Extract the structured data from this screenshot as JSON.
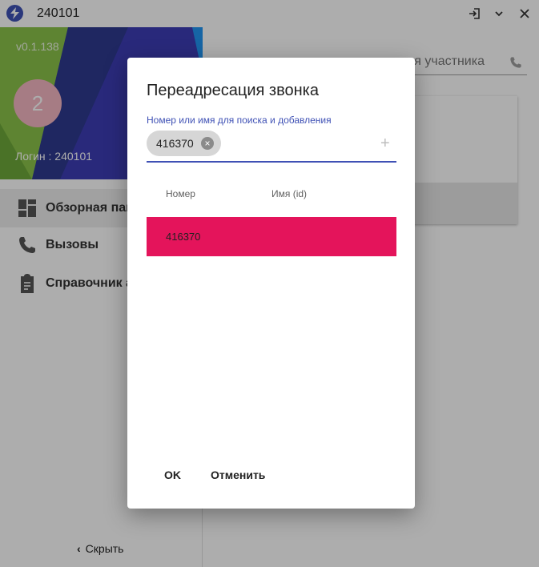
{
  "window": {
    "title": "240101",
    "icon": "lightning-icon",
    "controls": [
      "logout-icon",
      "chevron-down-icon",
      "close-icon"
    ]
  },
  "sidebar": {
    "version": "v0.1.138",
    "avatar_initial": "2",
    "login": "Логин : 240101",
    "items": [
      {
        "label": "Обзорная пан",
        "icon": "dashboard-icon",
        "active": true
      },
      {
        "label": "Вызовы",
        "icon": "phone-icon",
        "active": false
      },
      {
        "label": "Справочник а",
        "icon": "clipboard-icon",
        "active": false
      }
    ],
    "hide_label": "Скрыть"
  },
  "main": {
    "participant_placeholder": "я участника"
  },
  "dialog": {
    "title": "Переадресация звонка",
    "field_label": "Номер или имя для поиска и добавления",
    "chip_value": "416370",
    "columns": [
      "Номер",
      "Имя (id)"
    ],
    "rows": [
      {
        "number": "416370",
        "name": ""
      }
    ],
    "ok_label": "OK",
    "cancel_label": "Отменить"
  },
  "colors": {
    "accent": "#3f51b5",
    "row_highlight": "#e4145b",
    "avatar": "#f5b7c3"
  }
}
